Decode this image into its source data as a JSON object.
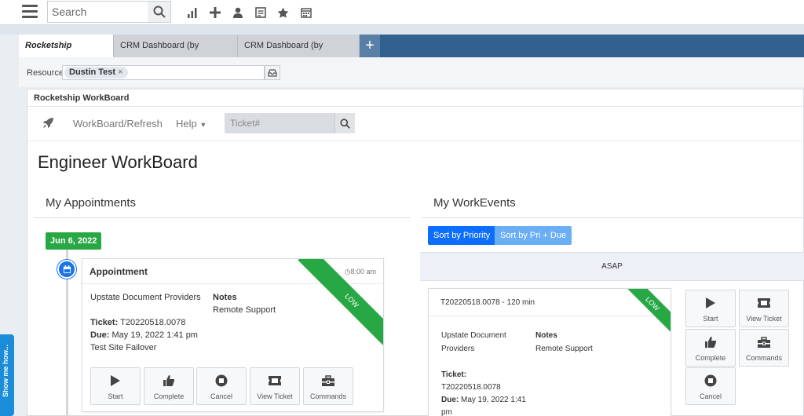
{
  "topbar": {
    "search_placeholder": "Search",
    "icons": [
      "menu-icon",
      "search-icon",
      "chart-icon",
      "plus-icon",
      "user-icon",
      "invoice-icon",
      "star-icon",
      "calendar-icon"
    ]
  },
  "tabs": [
    {
      "label": "Rocketship WorkBoard",
      "active": true
    },
    {
      "label": "CRM Dashboard (by Resource)",
      "active": false
    },
    {
      "label": "CRM Dashboard (by Territory)",
      "active": false
    }
  ],
  "resource": {
    "label": "Resource",
    "chip": "Dustin Test",
    "chip_remove": "×"
  },
  "panel": {
    "title": "Rocketship WorkBoard",
    "nav": {
      "workboard": "WorkBoard/Refresh",
      "help": "Help",
      "ticket_placeholder": "Ticket#"
    },
    "page_title": "Engineer WorkBoard"
  },
  "appointments": {
    "title": "My Appointments",
    "date": "Jun 6, 2022",
    "card": {
      "title": "Appointment",
      "time": "8:00 am",
      "priority": "LOW",
      "company": "Upstate Document Providers",
      "notes_label": "Notes",
      "notes": "Remote Support",
      "ticket_label": "Ticket:",
      "ticket": "T20220518.0078",
      "due_label": "Due:",
      "due": "May 19, 2022 1:41 pm",
      "summary": "Test Site Failover"
    },
    "actions": [
      "Start",
      "Complete",
      "Cancel",
      "View Ticket",
      "Commands"
    ]
  },
  "workevents": {
    "title": "My WorkEvents",
    "sort_priority": "Sort by Priority",
    "sort_pri_due": "Sort by Pri + Due",
    "group": "ASAP",
    "card": {
      "header": "T20220518.0078 - 120 min",
      "priority": "LOW",
      "company_line1": "Upstate Document",
      "company_line2": "Providers",
      "notes_label": "Notes",
      "notes": "Remote Support",
      "ticket_label": "Ticket:",
      "ticket": "T20220518.0078",
      "due_label": "Due:",
      "due_line1": "May 19, 2022 1:41",
      "due_line2": "pm"
    },
    "actions": [
      "Start",
      "View Ticket",
      "Complete",
      "Commands",
      "Cancel"
    ]
  },
  "showme": "Show me how...",
  "colors": {
    "accent": "#31628f",
    "green": "#28a745",
    "primary": "#0d6efd",
    "primary_light": "#6aaef5"
  }
}
